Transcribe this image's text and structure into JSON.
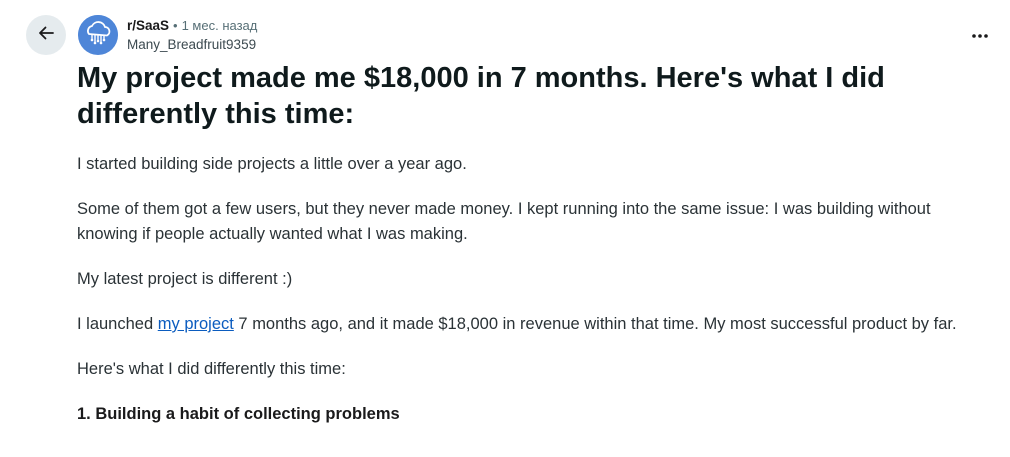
{
  "header": {
    "subreddit": "r/SaaS",
    "separator": "•",
    "time_ago": "1 мес. назад",
    "author": "Many_Breadfruit9359",
    "more_label": "•••"
  },
  "post": {
    "title": "My project made me $18,000 in 7 months. Here's what I did differently this time:",
    "paragraphs": {
      "p1": "I started building side projects a little over a year ago.",
      "p2": "Some of them got a few users, but they never made money. I kept running into the same issue: I was building without knowing if people actually wanted what I was making.",
      "p3": "My latest project is different :)",
      "p4_before": "I launched ",
      "p4_link": "my project",
      "p4_after": " 7 months ago, and it made $18,000 in revenue within that time. My most successful product by far.",
      "p5": "Here's what I did differently this time:"
    },
    "section_heading": "1. Building a habit of collecting problems"
  },
  "colors": {
    "link": "#0b5cbf",
    "avatar_bg": "#4e86d8",
    "back_button_bg": "#e5ebee"
  },
  "icons": {
    "back": "arrow-left-icon",
    "more": "ellipsis-icon",
    "avatar": "cloud-circuit-icon"
  }
}
